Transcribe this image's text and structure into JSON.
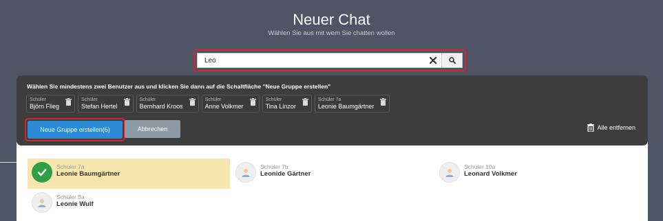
{
  "header": {
    "title": "Neuer Chat",
    "subtitle": "Wählen Sie aus mit wem Sie chatten wollen"
  },
  "search": {
    "value": "Leo",
    "clear_icon": "close-icon",
    "search_icon": "search-icon"
  },
  "selection_panel": {
    "instruction": "Wählen Sie mindestens zwei Benutzer aus und klicken Sie dann auf die Schaltfläche \"Neue Gruppe erstellen\"",
    "chips": [
      {
        "class": "Schüler",
        "name": "Björn Flieg"
      },
      {
        "class": "Schüler",
        "name": "Stefan Hertel"
      },
      {
        "class": "Schüler",
        "name": "Bernhard Kroos"
      },
      {
        "class": "Schüler",
        "name": "Anne Volkmer"
      },
      {
        "class": "Schüler",
        "name": "Tina Linzor"
      },
      {
        "class": "Schüler 7a",
        "name": "Leonie Baumgärtner"
      }
    ],
    "create_group_label": "Neue Gruppe erstellen(6)",
    "cancel_label": "Abbrechen",
    "remove_all_label": "Alle entfernen"
  },
  "results": [
    {
      "class": "Schüler 7a",
      "name": "Leonie Baumgärtner",
      "selected": true
    },
    {
      "class": "Schüler 7b",
      "name": "Leonide Gärtner",
      "selected": false
    },
    {
      "class": "Schüler 10a",
      "name": "Leonard Volkmer",
      "selected": false
    },
    {
      "class": "Schüler 5a",
      "name": "Leonie Wulf",
      "selected": false
    }
  ],
  "colors": {
    "header_bg": "#4f5565",
    "primary": "#2b8bd4",
    "highlight": "#d6262b",
    "selected_row": "#f7e7ae",
    "check": "#2e9f47"
  }
}
